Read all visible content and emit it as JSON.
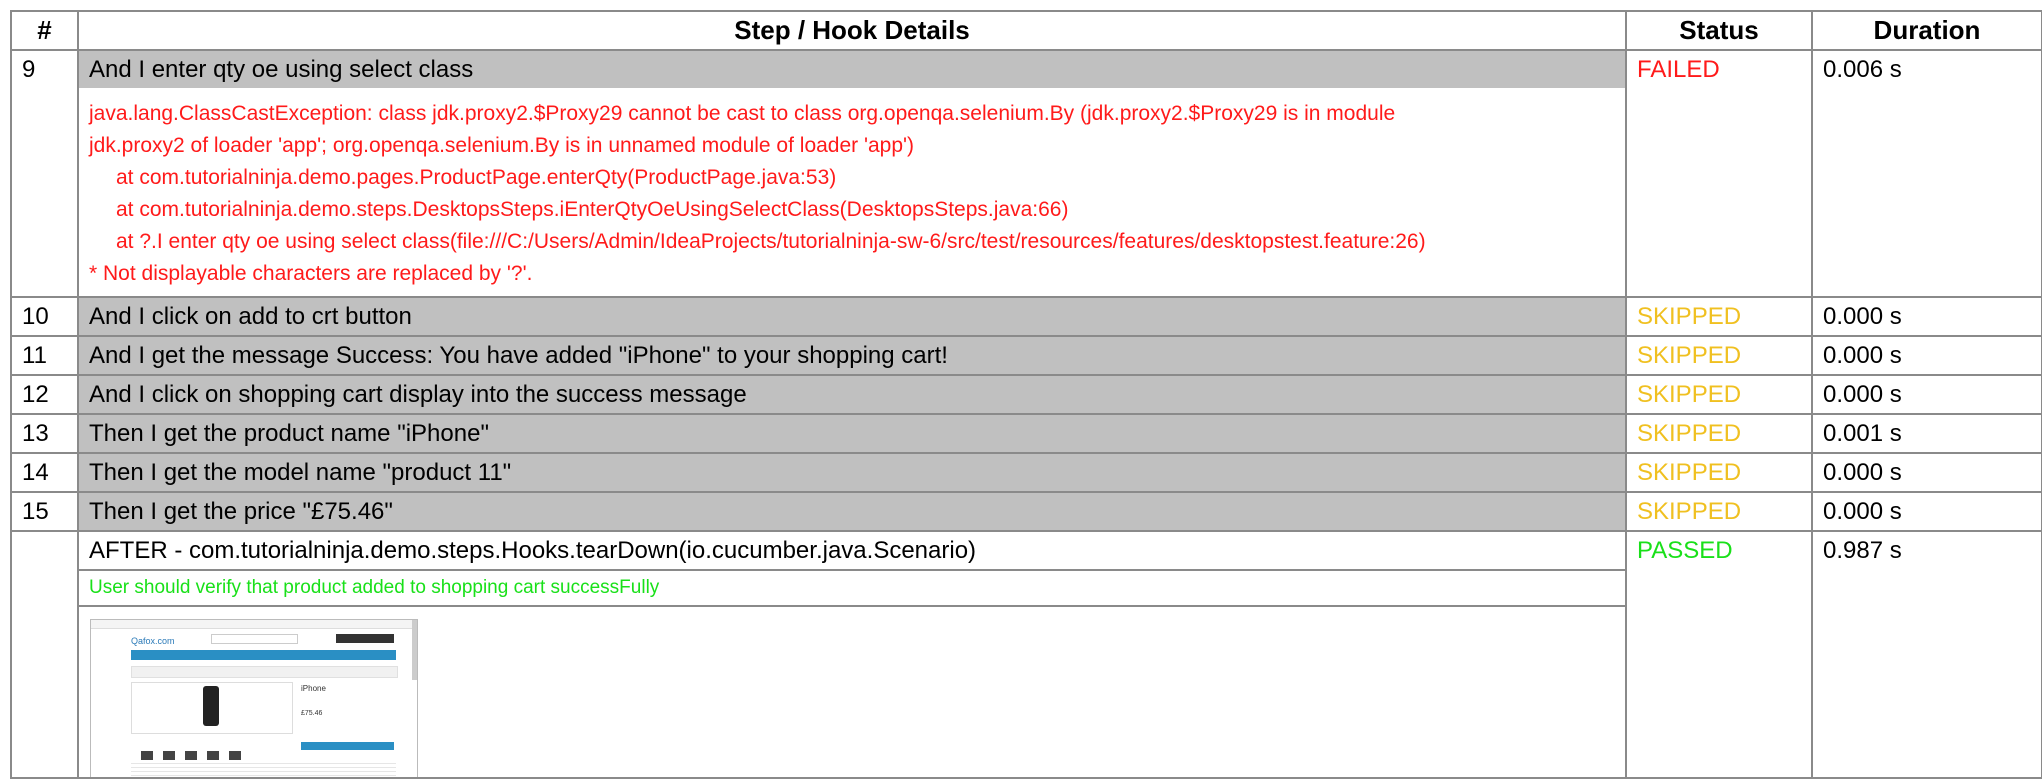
{
  "headers": {
    "num": "#",
    "step": "Step / Hook Details",
    "status": "Status",
    "duration": "Duration"
  },
  "failed_row": {
    "num": "9",
    "step": "And I enter qty oe using select class",
    "status": "FAILED",
    "duration": "0.006 s",
    "trace_lines": [
      "java.lang.ClassCastException: class jdk.proxy2.$Proxy29 cannot be cast to class org.openqa.selenium.By (jdk.proxy2.$Proxy29 is in module",
      "jdk.proxy2 of loader 'app'; org.openqa.selenium.By is in unnamed module of loader 'app')",
      "at com.tutorialninja.demo.pages.ProductPage.enterQty(ProductPage.java:53)",
      "at com.tutorialninja.demo.steps.DesktopsSteps.iEnterQtyOeUsingSelectClass(DesktopsSteps.java:66)",
      "at ?.I enter qty oe using select class(file:///C:/Users/Admin/IdeaProjects/tutorialninja-sw-6/src/test/resources/features/desktopstest.feature:26)",
      "* Not displayable characters are replaced by '?'."
    ]
  },
  "skipped_rows": [
    {
      "num": "10",
      "step": "And I click on add to crt button",
      "status": "SKIPPED",
      "duration": "0.000 s"
    },
    {
      "num": "11",
      "step": "And I get the message Success: You have added \"iPhone\" to your shopping cart!",
      "status": "SKIPPED",
      "duration": "0.000 s"
    },
    {
      "num": "12",
      "step": "And I click on shopping cart display into the success message",
      "status": "SKIPPED",
      "duration": "0.000 s"
    },
    {
      "num": "13",
      "step": "Then I get the product name \"iPhone\"",
      "status": "SKIPPED",
      "duration": "0.001 s"
    },
    {
      "num": "14",
      "step": "Then I get the model name \"product 11\"",
      "status": "SKIPPED",
      "duration": "0.000 s"
    },
    {
      "num": "15",
      "step": "Then I get the price \"£75.46\"",
      "status": "SKIPPED",
      "duration": "0.000 s"
    }
  ],
  "hook_row": {
    "num": "",
    "step": "AFTER - com.tutorialninja.demo.steps.Hooks.tearDown(io.cucumber.java.Scenario)",
    "message": "User should verify that product added to shopping cart successFully",
    "status": "PASSED",
    "duration": "0.987 s",
    "screenshot": {
      "logo": "Qafox.com",
      "product_title": "iPhone",
      "price": "£75.46"
    }
  },
  "colors": {
    "failed": "#ff1a1a",
    "skipped": "#f0c020",
    "passed": "#19e019",
    "step_bg": "#c0c0c0"
  }
}
